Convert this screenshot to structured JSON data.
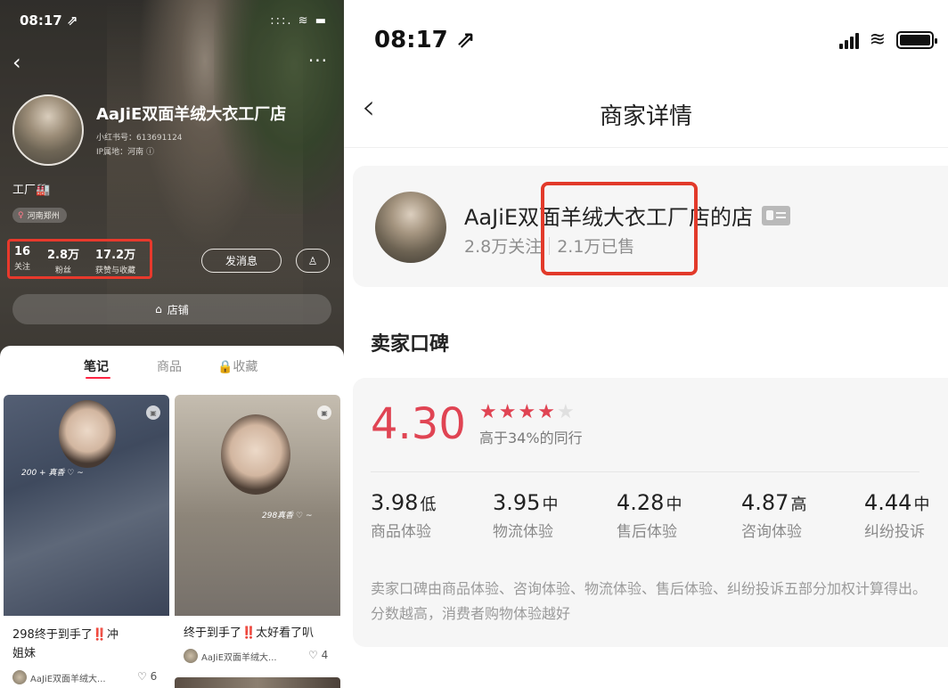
{
  "left": {
    "status_time": "08:17 ⇗",
    "status_icons": ":::. ≋ ▬",
    "back_icon": "‹",
    "more_icon": "···",
    "profile": {
      "name": "AaJiE双面羊绒大衣工厂店",
      "redbook_id": "小红书号：613691124",
      "ip_location": "IP属地：河南 ⓘ",
      "tag_factory": "工厂🏭",
      "location_pill": "河南郑州"
    },
    "stats": [
      {
        "value": "16",
        "label": "关注"
      },
      {
        "value": "2.8万",
        "label": "粉丝"
      },
      {
        "value": "17.2万",
        "label": "获赞与收藏"
      }
    ],
    "message_button": "发消息",
    "follow_icon": "♙",
    "shop_button": "店铺",
    "tabs": [
      "笔记",
      "商品",
      "🔒收藏"
    ],
    "cards": [
      {
        "title_line1": "298终于到手了‼️冲",
        "title_line2": "姐妹",
        "author": "AaJiE双面羊绒大...",
        "likes": "♡ 6",
        "img_tag": "200 + 真香 ♡ ~"
      },
      {
        "title_line1": "终于到手了‼️太好看了叭",
        "author": "AaJiE双面羊绒大...",
        "likes": "♡ 4",
        "img_tag": "298真香 ♡ ~"
      }
    ]
  },
  "right": {
    "status_time": "08:17 ⇗",
    "back_icon": "‹",
    "page_title": "商家详情",
    "merchant": {
      "name": "AaJiE双面羊绒大衣工厂店的店",
      "followers": "2.8万关注",
      "sold": "2.1万已售"
    },
    "section_title": "卖家口碑",
    "rating": {
      "score": "4.30",
      "stars_filled": 4,
      "stars_total": 5,
      "compare_text": "高于34%的同行"
    },
    "metrics": [
      {
        "value": "3.98",
        "level": "低",
        "name": "商品体验"
      },
      {
        "value": "3.95",
        "level": "中",
        "name": "物流体验"
      },
      {
        "value": "4.28",
        "level": "中",
        "name": "售后体验"
      },
      {
        "value": "4.87",
        "level": "高",
        "name": "咨询体验"
      },
      {
        "value": "4.44",
        "level": "中",
        "name": "纠纷投诉"
      }
    ],
    "note": "卖家口碑由商品体验、咨询体验、物流体验、售后体验、纠纷投诉五部分加权计算得出。分数越高，消费者购物体验越好"
  },
  "colors": {
    "accent_red": "#e04453",
    "highlight_box": "#e23a2a",
    "tab_underline": "#ff2442"
  }
}
